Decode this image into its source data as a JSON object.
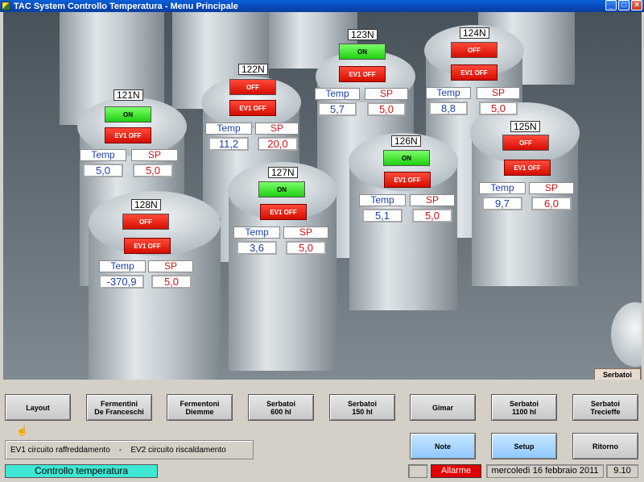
{
  "window": {
    "title": "TAC System Controllo Temperatura - Menu Principale"
  },
  "tanks": {
    "t121": {
      "id": "121N",
      "status": "ON",
      "valve": "EV1 OFF",
      "temp_label": "Temp",
      "sp_label": "SP",
      "temp": "5,0",
      "sp": "5,0"
    },
    "t122": {
      "id": "122N",
      "status": "OFF",
      "valve": "EV1 OFF",
      "temp_label": "Temp",
      "sp_label": "SP",
      "temp": "11,2",
      "sp": "20,0"
    },
    "t123": {
      "id": "123N",
      "status": "ON",
      "valve": "EV1 OFF",
      "temp_label": "Temp",
      "sp_label": "SP",
      "temp": "5,7",
      "sp": "5,0"
    },
    "t124": {
      "id": "124N",
      "status": "OFF",
      "valve": "EV1 OFF",
      "temp_label": "Temp",
      "sp_label": "SP",
      "temp": "8,8",
      "sp": "5,0"
    },
    "t125": {
      "id": "125N",
      "status": "OFF",
      "valve": "EV1 OFF",
      "temp_label": "Temp",
      "sp_label": "SP",
      "temp": "9,7",
      "sp": "6,0"
    },
    "t126": {
      "id": "126N",
      "status": "ON",
      "valve": "EV1 OFF",
      "temp_label": "Temp",
      "sp_label": "SP",
      "temp": "5,1",
      "sp": "5,0"
    },
    "t127": {
      "id": "127N",
      "status": "ON",
      "valve": "EV1 OFF",
      "temp_label": "Temp",
      "sp_label": "SP",
      "temp": "3,6",
      "sp": "5,0"
    },
    "t128": {
      "id": "128N",
      "status": "OFF",
      "valve": "EV1 OFF",
      "temp_label": "Temp",
      "sp_label": "SP",
      "temp": "-370,9",
      "sp": "5,0"
    }
  },
  "scene_tag": "Serbatoi\n600 hl",
  "nav": {
    "layout": "Layout",
    "fermentini": "Fermentini\nDe Franceschi",
    "fermentoni": "Fermentoni\nDiemme",
    "serbatoi600": "Serbatoi\n600 hl",
    "serbatoi150": "Serbatoi\n150 hl",
    "gimar": "Gimar",
    "serbatoi1100": "Serbatoi\n1100 hl",
    "trecieffe": "Serbatoi\nTrecieffe",
    "note": "Note",
    "setup": "Setup",
    "ritorno": "Ritorno"
  },
  "legend": "EV1 circuito raffreddamento    -    EV2 circuito riscaldamento",
  "status": {
    "left": "Controllo temperatura",
    "alarm": "Allarme",
    "date": "mercoledì 16 febbraio 2011",
    "time": "9.10"
  },
  "colors": {
    "on": "#1fcf12",
    "off": "#d40d00",
    "status_bg": "#3fe7d5",
    "alarm": "#e00000",
    "temp_text": "#1a3fa8",
    "sp_text": "#cc1111"
  }
}
